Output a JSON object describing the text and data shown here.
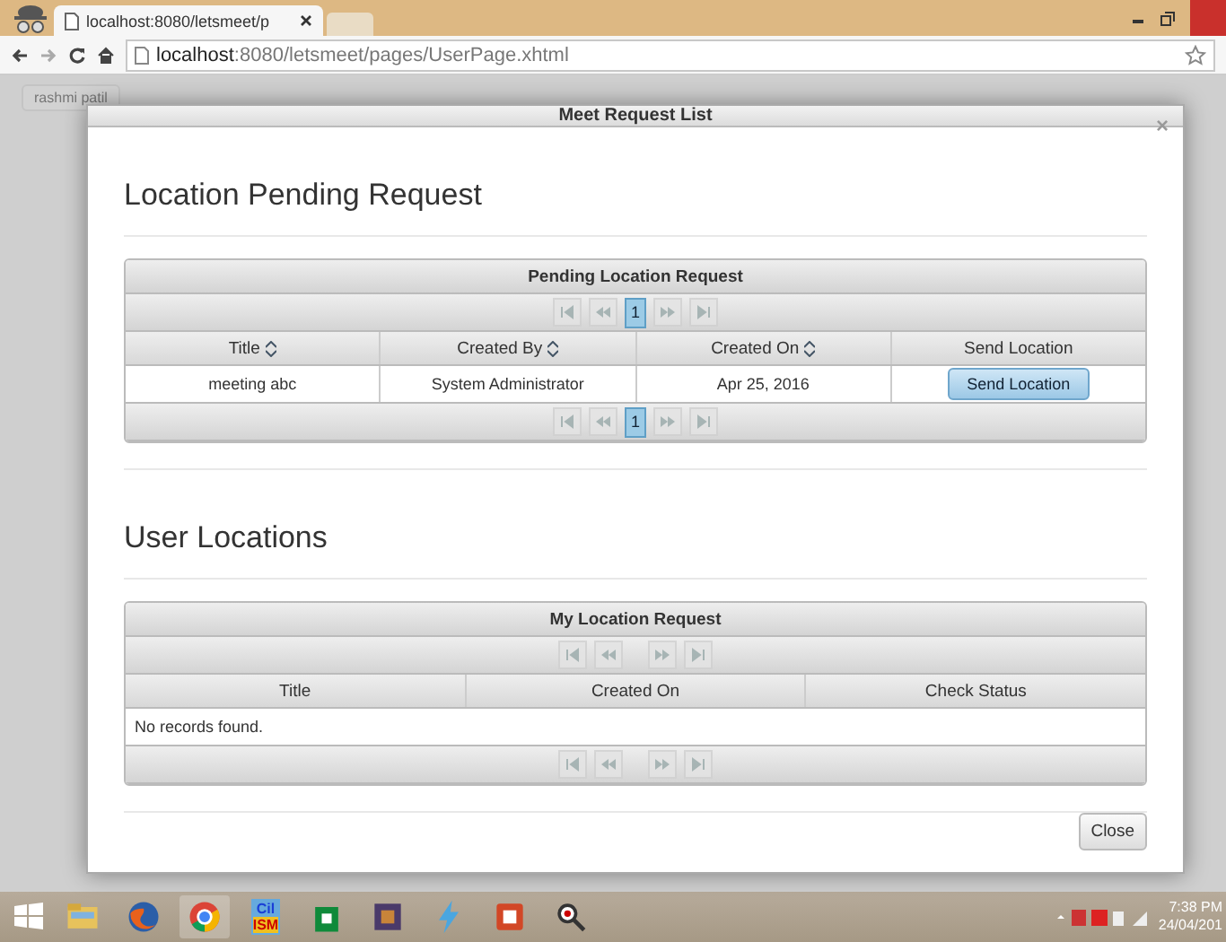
{
  "browser": {
    "tab_title": "localhost:8080/letsmeet/p",
    "address_host": "localhost",
    "address_path": ":8080/letsmeet/pages/UserPage.xhtml"
  },
  "background": {
    "menu_label": "rashmi patil"
  },
  "dialog": {
    "title": "Meet Request List",
    "close_glyph": "×",
    "sections": [
      {
        "heading": "Location Pending Request",
        "table": {
          "caption": "Pending Location Request",
          "pages_top": [
            {
              "label": "1",
              "selected": true
            }
          ],
          "pages_bottom": [
            {
              "label": "1",
              "selected": true
            }
          ],
          "columns": [
            {
              "label": "Title",
              "sortable": true
            },
            {
              "label": "Created By",
              "sortable": true
            },
            {
              "label": "Created On",
              "sortable": true
            },
            {
              "label": "Send Location",
              "sortable": false
            }
          ],
          "rows": [
            [
              {
                "kind": "text",
                "text": "meeting abc"
              },
              {
                "kind": "text",
                "text": "System Administrator"
              },
              {
                "kind": "text",
                "text": "Apr 25, 2016"
              },
              {
                "kind": "button",
                "text": "Send Location"
              }
            ]
          ]
        }
      },
      {
        "heading": "User Locations",
        "table": {
          "caption": "My Location Request",
          "columns": [
            {
              "label": "Title",
              "sortable": false
            },
            {
              "label": "Created On",
              "sortable": false
            },
            {
              "label": "Check Status",
              "sortable": false
            }
          ],
          "empty_message": "No records found."
        }
      }
    ],
    "footer_button": "Close"
  },
  "taskbar": {
    "apps": [
      {
        "kind": "folder"
      },
      {
        "kind": "firefox"
      },
      {
        "kind": "chrome",
        "selected": true
      },
      {
        "kind": "ism",
        "lines": [
          "Cil",
          "ISM"
        ]
      },
      {
        "kind": "store"
      },
      {
        "kind": "chip"
      },
      {
        "kind": "bolt"
      },
      {
        "kind": "slides"
      },
      {
        "kind": "magnifier"
      }
    ],
    "time": "7:38 PM",
    "date": "24/04/201"
  }
}
